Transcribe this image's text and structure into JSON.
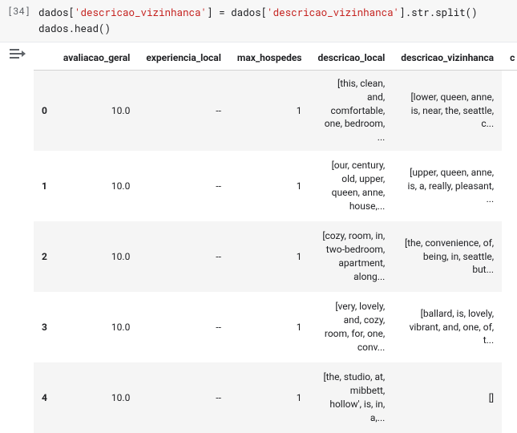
{
  "cell": {
    "exec_count": "[34]",
    "code_html": "dados[<span class='k-str'>'descricao_vizinhanca'</span>] <span class='k-punct'>=</span> dados[<span class='k-str'>'descricao_vizinhanca'</span>].str.split()\ndados.head()"
  },
  "dataframe": {
    "columns": [
      "",
      "avaliacao_geral",
      "experiencia_local",
      "max_hospedes",
      "descricao_local",
      "descricao_vizinhanca",
      "c"
    ],
    "rows": [
      {
        "index": "0",
        "cells": [
          "10.0",
          "--",
          "1",
          "[this, clean, and, comfortable, one, bedroom, ...",
          "[lower, queen, anne, is, near, the, seattle, c..."
        ]
      },
      {
        "index": "1",
        "cells": [
          "10.0",
          "--",
          "1",
          "[our, century, old, upper, queen, anne, house,...",
          "[upper, queen, anne, is, a, really, pleasant, ..."
        ]
      },
      {
        "index": "2",
        "cells": [
          "10.0",
          "--",
          "1",
          "[cozy, room, in, two-bedroom, apartment, along...",
          "[the, convenience, of, being, in, seattle, but..."
        ]
      },
      {
        "index": "3",
        "cells": [
          "10.0",
          "--",
          "1",
          "[very, lovely, and, cozy, room, for, one, conv...",
          "[ballard, is, lovely, vibrant, and, one, of, t..."
        ]
      },
      {
        "index": "4",
        "cells": [
          "10.0",
          "--",
          "1",
          "[the, studio, at, mibbett, hollow', is, in, a,...",
          "[]"
        ]
      }
    ]
  }
}
